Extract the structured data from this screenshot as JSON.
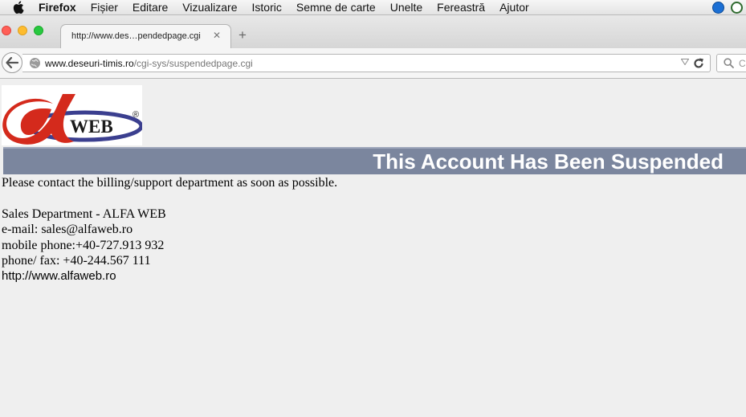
{
  "menubar": {
    "app_name": "Firefox",
    "items": [
      "Fișier",
      "Editare",
      "Vizualizare",
      "Istoric",
      "Semne de carte",
      "Unelte",
      "Fereastră",
      "Ajutor"
    ]
  },
  "tab": {
    "title": "http://www.des…pendedpage.cgi",
    "close_glyph": "✕",
    "new_tab_glyph": "+"
  },
  "navbar": {
    "url_host": "www.deseuri-timis.ro",
    "url_path": "/cgi-sys/suspendedpage.cgi",
    "search_placeholder": "C"
  },
  "page": {
    "logo_text": "WEB",
    "logo_registered": "®",
    "banner_title": "This Account Has Been Suspended",
    "message": "Please contact the billing/support department as soon as possible.",
    "contact_lines": [
      "Sales Department - ALFA WEB",
      "e-mail: sales@alfaweb.ro",
      "mobile phone:+40-727.913 932",
      "phone/ fax: +40-244.567 111"
    ],
    "website": "http://www.alfaweb.ro"
  },
  "colors": {
    "banner": "#7b869e",
    "logo_red": "#d42a1c",
    "logo_blue": "#3b3f8f",
    "close": "#ff5f57",
    "minimize": "#febc2e",
    "zoom": "#28c840"
  }
}
